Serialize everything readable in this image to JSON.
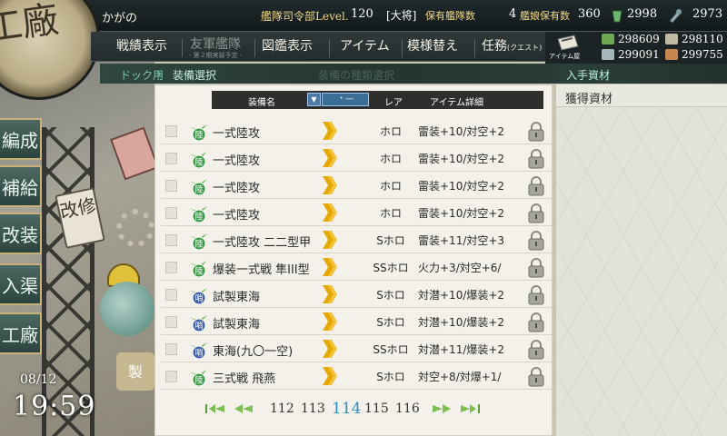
{
  "topbar": {
    "username": "かがの",
    "level_label": "艦隊司令部Level.",
    "level": "120",
    "rank": "[大将]",
    "fleet_count_label": "保有艦隊数",
    "fleet_count": "4",
    "ship_count_label": "艦娘保有数",
    "ship_count": "360",
    "buckets": "2998",
    "dev_materials": "2973"
  },
  "menu": {
    "items": [
      {
        "label": "戦績表示"
      },
      {
        "label": "友軍艦隊",
        "sub": "- 第２期実装予定 -"
      },
      {
        "label": "図鑑表示"
      },
      {
        "label": "アイテム"
      },
      {
        "label": "模様替え"
      },
      {
        "label": "任務",
        "sub": "(クエスト)"
      }
    ],
    "shop_label": "アイテム屋"
  },
  "resources": {
    "fuel": "298609",
    "ammo": "298110",
    "steel": "299091",
    "bauxite": "299755"
  },
  "left": {
    "emblem": "工廠",
    "buttons": [
      "編成",
      "補給",
      "改装",
      "入渠",
      "工廠"
    ],
    "sign": "改修",
    "build_label": "製",
    "date": "08/12",
    "time": "19:59"
  },
  "breadcrumb": {
    "first": "ドック用",
    "second": "装備選択",
    "ghost": "装備の種類選択"
  },
  "right": {
    "header": "入手資材",
    "panel_title": "獲得資材"
  },
  "list": {
    "headers": {
      "name": "装備名",
      "sort_icon": "▼",
      "sort2": "・—",
      "rare": "レア",
      "detail": "アイテム詳細"
    },
    "rows": [
      {
        "name": "一式陸攻",
        "badge": "陸",
        "badge_color": "#3a9a47",
        "rare": "ホロ",
        "detail": "雷装+10/対空+2"
      },
      {
        "name": "一式陸攻",
        "badge": "陸",
        "badge_color": "#3a9a47",
        "rare": "ホロ",
        "detail": "雷装+10/対空+2"
      },
      {
        "name": "一式陸攻",
        "badge": "陸",
        "badge_color": "#3a9a47",
        "rare": "ホロ",
        "detail": "雷装+10/対空+2"
      },
      {
        "name": "一式陸攻",
        "badge": "陸",
        "badge_color": "#3a9a47",
        "rare": "ホロ",
        "detail": "雷装+10/対空+2"
      },
      {
        "name": "一式陸攻 二二型甲",
        "badge": "陸",
        "badge_color": "#3a9a47",
        "rare": "Sホロ",
        "detail": "雷装+11/対空+3"
      },
      {
        "name": "爆装一式戦 隼III型",
        "badge": "陸",
        "badge_color": "#3a9a47",
        "rare": "SSホロ",
        "detail": "火力+3/対空+6/"
      },
      {
        "name": "試製東海",
        "badge": "哨",
        "badge_color": "#3f61a7",
        "rare": "Sホロ",
        "detail": "対潜+10/爆装+2"
      },
      {
        "name": "試製東海",
        "badge": "哨",
        "badge_color": "#3f61a7",
        "rare": "Sホロ",
        "detail": "対潜+10/爆装+2"
      },
      {
        "name": "東海(九〇一空)",
        "badge": "哨",
        "badge_color": "#3f61a7",
        "rare": "SSホロ",
        "detail": "対潜+11/爆装+2"
      },
      {
        "name": "三式戦 飛燕",
        "badge": "陸",
        "badge_color": "#3a9a47",
        "rare": "Sホロ",
        "detail": "対空+8/対爆+1/"
      }
    ],
    "pager": {
      "pages": [
        "112",
        "113",
        "114",
        "115",
        "116"
      ],
      "current": "114"
    }
  },
  "colors": {
    "accent_gold": "#e5a800",
    "current_page": "#2d8fc4"
  }
}
